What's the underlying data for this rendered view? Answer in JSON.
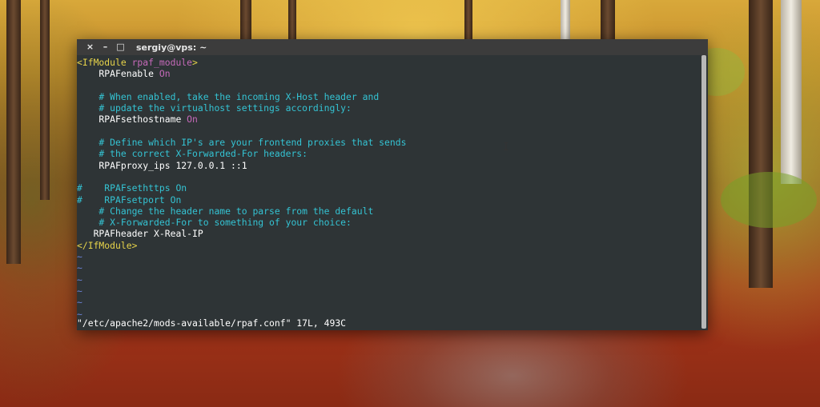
{
  "window": {
    "title": "sergiy@vps: ~",
    "close_label": "×",
    "minimize_label": "–",
    "maximize_label": "□"
  },
  "editor": {
    "lines": [
      [
        {
          "cls": "tag",
          "text": "<IfModule "
        },
        {
          "cls": "tagname",
          "text": "rpaf_module"
        },
        {
          "cls": "tag",
          "text": ">"
        }
      ],
      [
        {
          "cls": "kw",
          "text": "    RPAFenable "
        },
        {
          "cls": "val",
          "text": "On"
        }
      ],
      [
        {
          "cls": "kw",
          "text": ""
        }
      ],
      [
        {
          "cls": "cmt",
          "text": "    # When enabled, take the incoming X-Host header and"
        }
      ],
      [
        {
          "cls": "cmt",
          "text": "    # update the virtualhost settings accordingly:"
        }
      ],
      [
        {
          "cls": "kw",
          "text": "    RPAFsethostname "
        },
        {
          "cls": "val",
          "text": "On"
        }
      ],
      [
        {
          "cls": "kw",
          "text": ""
        }
      ],
      [
        {
          "cls": "cmt",
          "text": "    # Define which IP's are your frontend proxies that sends"
        }
      ],
      [
        {
          "cls": "cmt",
          "text": "    # the correct X-Forwarded-For headers:"
        }
      ],
      [
        {
          "cls": "kw",
          "text": "    RPAFproxy_ips 127.0.0.1 ::1"
        }
      ],
      [
        {
          "cls": "kw",
          "text": ""
        }
      ],
      [
        {
          "cls": "cmt",
          "text": "#    RPAFsethttps On"
        }
      ],
      [
        {
          "cls": "cmt",
          "text": "#    RPAFsetport On"
        }
      ],
      [
        {
          "cls": "cmt",
          "text": "    # Change the header name to parse from the default"
        }
      ],
      [
        {
          "cls": "cmt",
          "text": "    # X-Forwarded-For to something of your choice:"
        }
      ],
      [
        {
          "cls": "kw",
          "text": "   RPAFheader X-Real-IP"
        }
      ],
      [
        {
          "cls": "tag",
          "text": "</IfModule>"
        }
      ],
      [
        {
          "cls": "tilde",
          "text": "~"
        }
      ],
      [
        {
          "cls": "tilde",
          "text": "~"
        }
      ],
      [
        {
          "cls": "tilde",
          "text": "~"
        }
      ],
      [
        {
          "cls": "tilde",
          "text": "~"
        }
      ],
      [
        {
          "cls": "tilde",
          "text": "~"
        }
      ],
      [
        {
          "cls": "tilde",
          "text": "~"
        }
      ]
    ],
    "status_line": "\"/etc/apache2/mods-available/rpaf.conf\" 17L, 493C"
  },
  "colors": {
    "terminal_bg": "#2e3436",
    "comment": "#34c3d3",
    "keyword_value": "#c56ab9",
    "tag": "#e6d34a",
    "tilde": "#6c83d8"
  },
  "mouse_cursor_icon": "text-cursor-icon"
}
